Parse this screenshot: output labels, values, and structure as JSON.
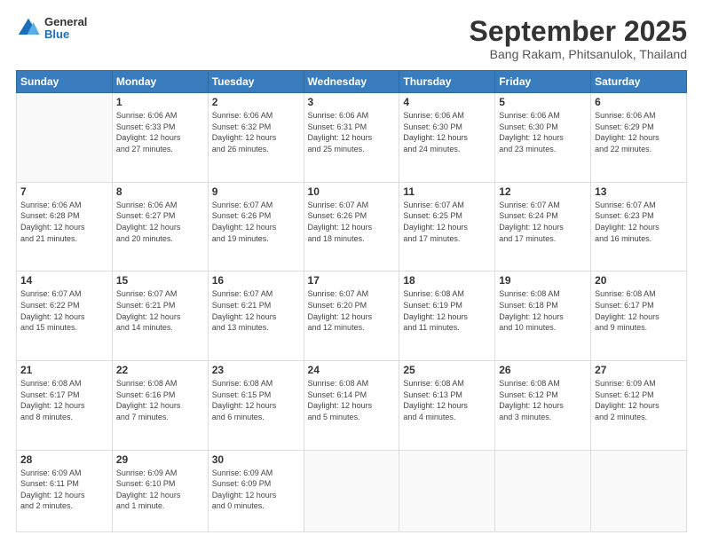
{
  "header": {
    "logo_general": "General",
    "logo_blue": "Blue",
    "main_title": "September 2025",
    "subtitle": "Bang Rakam, Phitsanulok, Thailand"
  },
  "calendar": {
    "days_of_week": [
      "Sunday",
      "Monday",
      "Tuesday",
      "Wednesday",
      "Thursday",
      "Friday",
      "Saturday"
    ],
    "weeks": [
      [
        {
          "num": "",
          "info": ""
        },
        {
          "num": "1",
          "info": "Sunrise: 6:06 AM\nSunset: 6:33 PM\nDaylight: 12 hours\nand 27 minutes."
        },
        {
          "num": "2",
          "info": "Sunrise: 6:06 AM\nSunset: 6:32 PM\nDaylight: 12 hours\nand 26 minutes."
        },
        {
          "num": "3",
          "info": "Sunrise: 6:06 AM\nSunset: 6:31 PM\nDaylight: 12 hours\nand 25 minutes."
        },
        {
          "num": "4",
          "info": "Sunrise: 6:06 AM\nSunset: 6:30 PM\nDaylight: 12 hours\nand 24 minutes."
        },
        {
          "num": "5",
          "info": "Sunrise: 6:06 AM\nSunset: 6:30 PM\nDaylight: 12 hours\nand 23 minutes."
        },
        {
          "num": "6",
          "info": "Sunrise: 6:06 AM\nSunset: 6:29 PM\nDaylight: 12 hours\nand 22 minutes."
        }
      ],
      [
        {
          "num": "7",
          "info": "Sunrise: 6:06 AM\nSunset: 6:28 PM\nDaylight: 12 hours\nand 21 minutes."
        },
        {
          "num": "8",
          "info": "Sunrise: 6:06 AM\nSunset: 6:27 PM\nDaylight: 12 hours\nand 20 minutes."
        },
        {
          "num": "9",
          "info": "Sunrise: 6:07 AM\nSunset: 6:26 PM\nDaylight: 12 hours\nand 19 minutes."
        },
        {
          "num": "10",
          "info": "Sunrise: 6:07 AM\nSunset: 6:26 PM\nDaylight: 12 hours\nand 18 minutes."
        },
        {
          "num": "11",
          "info": "Sunrise: 6:07 AM\nSunset: 6:25 PM\nDaylight: 12 hours\nand 17 minutes."
        },
        {
          "num": "12",
          "info": "Sunrise: 6:07 AM\nSunset: 6:24 PM\nDaylight: 12 hours\nand 17 minutes."
        },
        {
          "num": "13",
          "info": "Sunrise: 6:07 AM\nSunset: 6:23 PM\nDaylight: 12 hours\nand 16 minutes."
        }
      ],
      [
        {
          "num": "14",
          "info": "Sunrise: 6:07 AM\nSunset: 6:22 PM\nDaylight: 12 hours\nand 15 minutes."
        },
        {
          "num": "15",
          "info": "Sunrise: 6:07 AM\nSunset: 6:21 PM\nDaylight: 12 hours\nand 14 minutes."
        },
        {
          "num": "16",
          "info": "Sunrise: 6:07 AM\nSunset: 6:21 PM\nDaylight: 12 hours\nand 13 minutes."
        },
        {
          "num": "17",
          "info": "Sunrise: 6:07 AM\nSunset: 6:20 PM\nDaylight: 12 hours\nand 12 minutes."
        },
        {
          "num": "18",
          "info": "Sunrise: 6:08 AM\nSunset: 6:19 PM\nDaylight: 12 hours\nand 11 minutes."
        },
        {
          "num": "19",
          "info": "Sunrise: 6:08 AM\nSunset: 6:18 PM\nDaylight: 12 hours\nand 10 minutes."
        },
        {
          "num": "20",
          "info": "Sunrise: 6:08 AM\nSunset: 6:17 PM\nDaylight: 12 hours\nand 9 minutes."
        }
      ],
      [
        {
          "num": "21",
          "info": "Sunrise: 6:08 AM\nSunset: 6:17 PM\nDaylight: 12 hours\nand 8 minutes."
        },
        {
          "num": "22",
          "info": "Sunrise: 6:08 AM\nSunset: 6:16 PM\nDaylight: 12 hours\nand 7 minutes."
        },
        {
          "num": "23",
          "info": "Sunrise: 6:08 AM\nSunset: 6:15 PM\nDaylight: 12 hours\nand 6 minutes."
        },
        {
          "num": "24",
          "info": "Sunrise: 6:08 AM\nSunset: 6:14 PM\nDaylight: 12 hours\nand 5 minutes."
        },
        {
          "num": "25",
          "info": "Sunrise: 6:08 AM\nSunset: 6:13 PM\nDaylight: 12 hours\nand 4 minutes."
        },
        {
          "num": "26",
          "info": "Sunrise: 6:08 AM\nSunset: 6:12 PM\nDaylight: 12 hours\nand 3 minutes."
        },
        {
          "num": "27",
          "info": "Sunrise: 6:09 AM\nSunset: 6:12 PM\nDaylight: 12 hours\nand 2 minutes."
        }
      ],
      [
        {
          "num": "28",
          "info": "Sunrise: 6:09 AM\nSunset: 6:11 PM\nDaylight: 12 hours\nand 2 minutes."
        },
        {
          "num": "29",
          "info": "Sunrise: 6:09 AM\nSunset: 6:10 PM\nDaylight: 12 hours\nand 1 minute."
        },
        {
          "num": "30",
          "info": "Sunrise: 6:09 AM\nSunset: 6:09 PM\nDaylight: 12 hours\nand 0 minutes."
        },
        {
          "num": "",
          "info": ""
        },
        {
          "num": "",
          "info": ""
        },
        {
          "num": "",
          "info": ""
        },
        {
          "num": "",
          "info": ""
        }
      ]
    ]
  }
}
